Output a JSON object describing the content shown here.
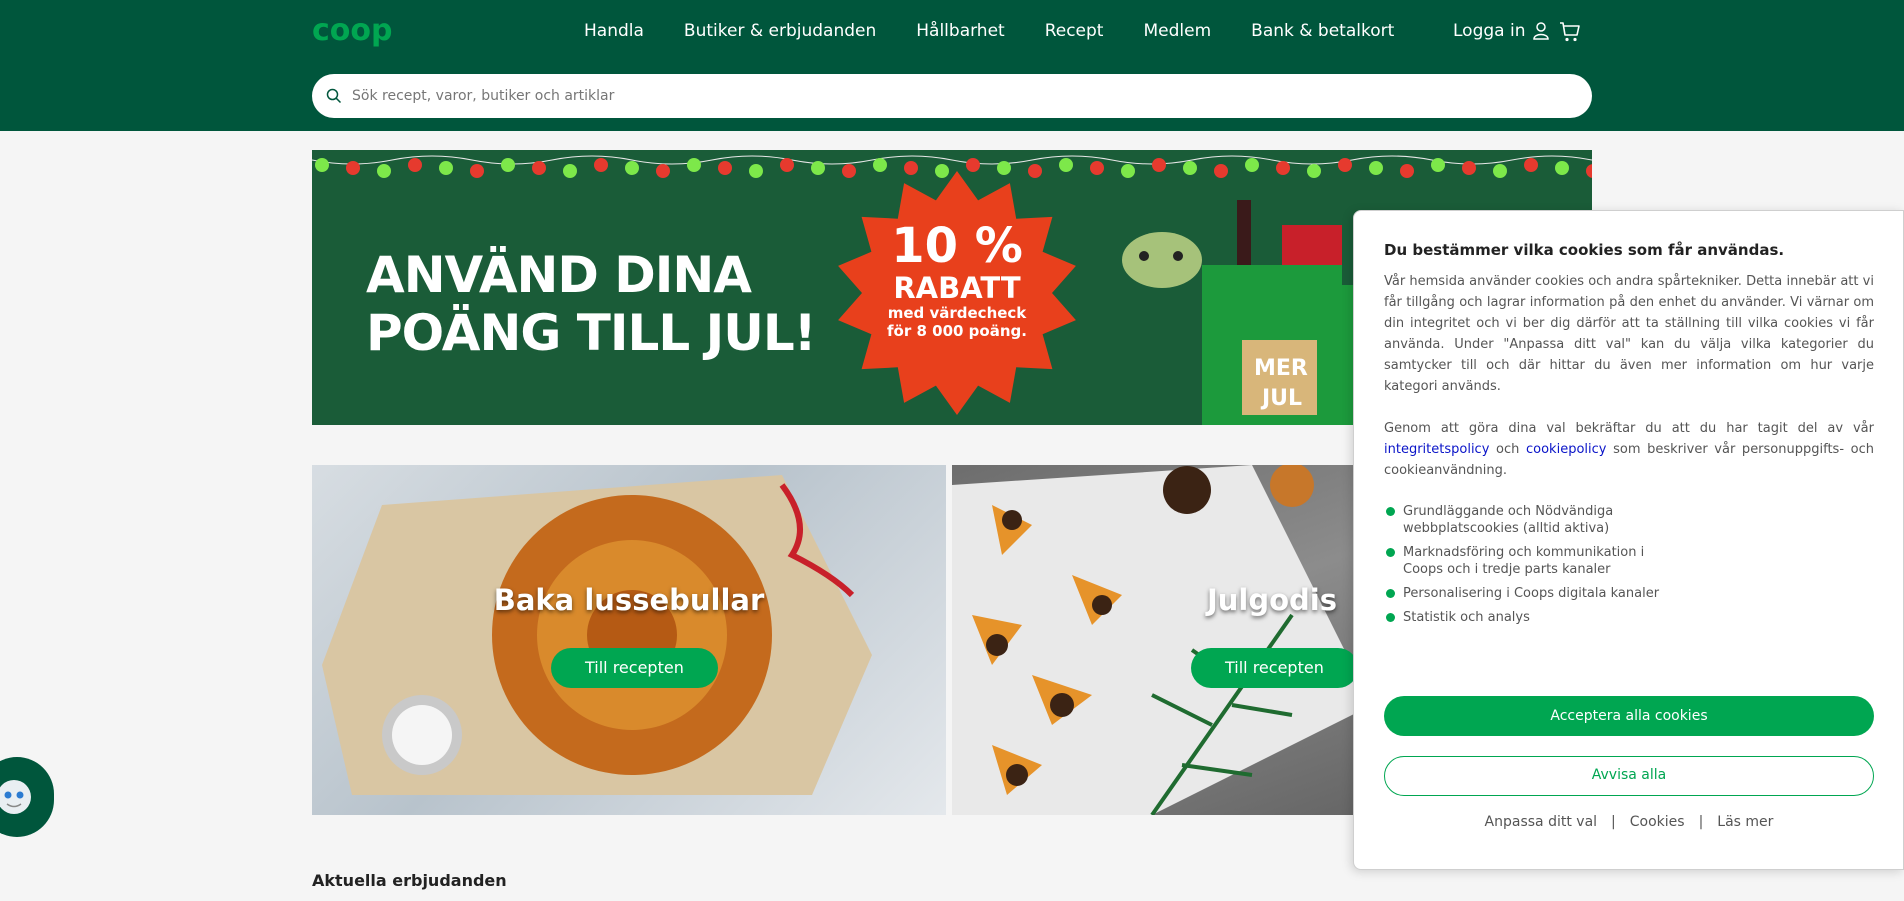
{
  "brand": {
    "logo_text": "coop",
    "primary": "#00563c",
    "accent": "#00a651"
  },
  "nav": {
    "items": [
      {
        "label": "Handla"
      },
      {
        "label": "Butiker & erbjudanden"
      },
      {
        "label": "Hållbarhet"
      },
      {
        "label": "Recept"
      },
      {
        "label": "Medlem"
      },
      {
        "label": "Bank & betalkort"
      }
    ],
    "login_label": "Logga in",
    "icons": [
      "user-icon",
      "cart-icon"
    ]
  },
  "search": {
    "placeholder": "Sök recept, varor, butiker och artiklar",
    "icon": "search-icon"
  },
  "banner": {
    "title_line1": "ANVÄND DINA",
    "title_line2": "POÄNG TILL JUL!",
    "burst_line1": "10 %",
    "burst_line2": "RABATT",
    "burst_line3": "med värdecheck",
    "burst_line4": "för 8 000 poäng.",
    "bag_text": "MER JUL"
  },
  "tiles": [
    {
      "title": "Baka lussebullar",
      "button": "Till recepten"
    },
    {
      "title": "Julgodis",
      "button": "Till recepten"
    }
  ],
  "section_title": "Aktuella erbjudanden",
  "cookie": {
    "title": "Du bestämmer vilka cookies som får användas.",
    "paragraph1": "Vår hemsida använder cookies och andra spårtekniker. Detta innebär att vi får tillgång och lagrar information på den enhet du använder. Vi värnar om din integritet och vi ber dig därför att ta ställning till vilka cookies vi får använda. Under \"Anpassa ditt val\" kan du välja vilka kategorier du samtycker till och där hittar du även mer information om hur varje kategori används.",
    "p2_before": "Genom att göra dina val bekräftar du att du har tagit del av vår ",
    "p2_link1": "integritetspolicy",
    "p2_middle": " och ",
    "p2_link2": "cookiepolicy",
    "p2_after": " som beskriver vår personuppgifts- och cookieanvändning.",
    "categories": [
      "Grundläggande och Nödvändiga webbplatscookies (alltid aktiva)",
      "Marknadsföring och kommunikation i Coops och i tredje parts kanaler",
      "Personalisering i Coops digitala kanaler",
      "Statistik och analys"
    ],
    "accept_label": "Acceptera alla cookies",
    "deny_label": "Avvisa alla",
    "link_customize": "Anpassa ditt val",
    "link_cookies": "Cookies",
    "link_readmore": "Läs mer",
    "separator": "|"
  }
}
